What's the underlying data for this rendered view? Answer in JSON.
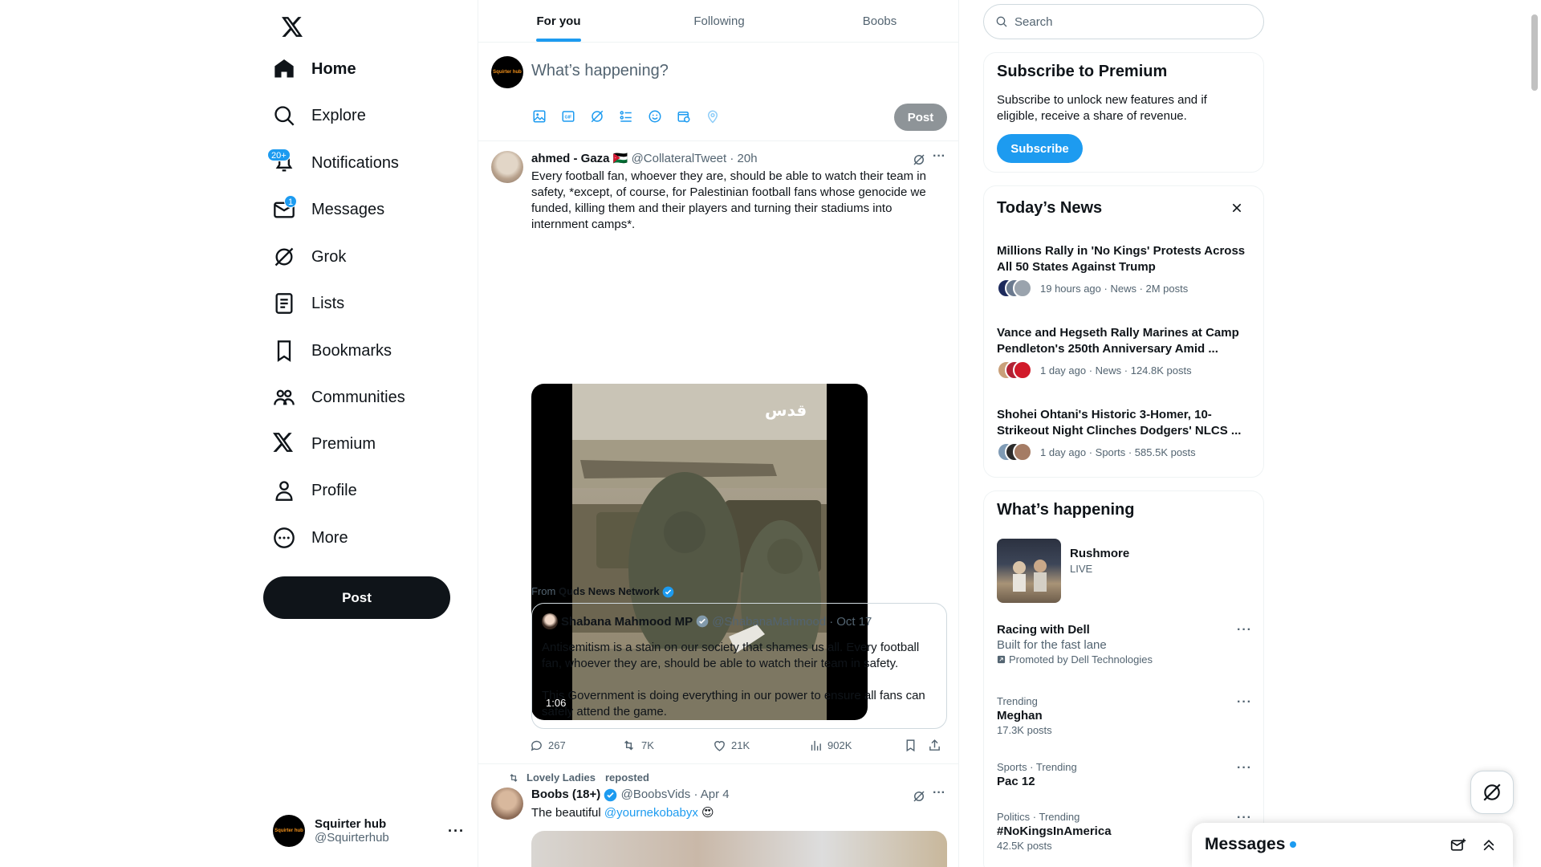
{
  "nav": {
    "items": [
      {
        "label": "Home",
        "icon": "home-icon",
        "active": true
      },
      {
        "label": "Explore",
        "icon": "search-icon"
      },
      {
        "label": "Notifications",
        "icon": "bell-icon",
        "badge": "20+"
      },
      {
        "label": "Messages",
        "icon": "mail-icon",
        "badge": "1"
      },
      {
        "label": "Grok",
        "icon": "grok-icon"
      },
      {
        "label": "Lists",
        "icon": "list-icon"
      },
      {
        "label": "Bookmarks",
        "icon": "bookmark-icon"
      },
      {
        "label": "Communities",
        "icon": "people-icon"
      },
      {
        "label": "Premium",
        "icon": "x-logo-icon"
      },
      {
        "label": "Profile",
        "icon": "person-icon"
      },
      {
        "label": "More",
        "icon": "more-circle-icon"
      }
    ],
    "post_label": "Post"
  },
  "account": {
    "name": "Squirter hub",
    "handle": "@Squirterhub",
    "avatar_text": "Squirter hub"
  },
  "tabs": [
    {
      "label": "For you",
      "active": true
    },
    {
      "label": "Following"
    },
    {
      "label": "Boobs"
    }
  ],
  "composer": {
    "placeholder": "What’s happening?",
    "post_label": "Post"
  },
  "tweets": [
    {
      "name": "ahmed - Gaza",
      "flag": "🇯🇴",
      "handle": "@CollateralTweet",
      "time": "20h",
      "text": "Every football fan, whoever they are, should be able to watch their team in safety, *except, of course, for Palestinian football fans whose genocide we funded, killing them and their players and turning their stadiums into internment camps*.",
      "video_duration": "1:06",
      "video_watermark": "قدس",
      "from_prefix": "From",
      "from_source": "Quds News Network",
      "quote": {
        "name": "Shabana Mahmood MP",
        "handle": "@ShabanaMahmood",
        "time": "Oct 17",
        "text1": "Antisemitism is a stain on our society that shames us all. Every football fan, whoever they are, should be able to watch their team in safety.",
        "text2": "This Government is doing everything in our power to ensure all fans can safely attend the game."
      },
      "replies": "267",
      "reposts": "7K",
      "likes": "21K",
      "views": "902K"
    },
    {
      "reposted_by": "Lovely Ladies",
      "reposted_label": "reposted",
      "name": "Boobs (18+)",
      "handle": "@BoobsVids",
      "time": "Apr 4",
      "text": "The beautiful",
      "mention": "@yournekobabyx",
      "emoji": "😍"
    }
  ],
  "search": {
    "placeholder": "Search"
  },
  "premium": {
    "title": "Subscribe to Premium",
    "desc": "Subscribe to unlock new features and if eligible, receive a share of revenue.",
    "button": "Subscribe"
  },
  "news": {
    "title": "Today’s News",
    "items": [
      {
        "title": "Millions Rally in 'No Kings' Protests Across All 50 States Against Trump",
        "meta": "19 hours ago · News · 2M posts",
        "avatar_colors": [
          "#1d2a5c",
          "#6b7a8f",
          "#9aa3ad"
        ]
      },
      {
        "title": "Vance and Hegseth Rally Marines at Camp Pendleton's 250th Anniversary Amid ...",
        "meta": "1 day ago · News · 124.8K posts",
        "avatar_colors": [
          "#c9a07a",
          "#b22234",
          "#d11a2a"
        ]
      },
      {
        "title": "Shohei Ohtani's Historic 3-Homer, 10-Strikeout Night Clinches Dodgers' NLCS ...",
        "meta": "1 day ago · Sports · 585.5K posts",
        "avatar_colors": [
          "#7f9bb5",
          "#2b2b2b",
          "#a57c65"
        ]
      }
    ]
  },
  "happening": {
    "title": "What’s happening",
    "live": {
      "name": "Rushmore",
      "status": "LIVE"
    },
    "promo": {
      "name": "Racing with Dell",
      "tagline": "Built for the fast lane",
      "promoted": "Promoted by Dell Technologies"
    },
    "trends": [
      {
        "context": "Trending",
        "name": "Meghan",
        "posts": "17.3K posts"
      },
      {
        "context": "Sports · Trending",
        "name": "Pac 12",
        "posts": ""
      },
      {
        "context": "Politics · Trending",
        "name": "#NoKingsInAmerica",
        "posts": "42.5K posts"
      }
    ]
  },
  "messages_drawer": {
    "title": "Messages"
  },
  "colors": {
    "accent": "#1d9bf0",
    "text": "#0f1419",
    "muted": "#536471",
    "border": "#eff3f4"
  }
}
